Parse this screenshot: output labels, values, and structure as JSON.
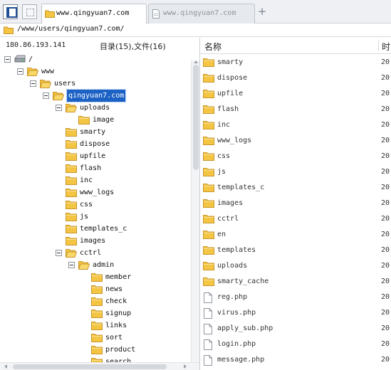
{
  "tabs": [
    {
      "label": "www.qingyuan7.com"
    },
    {
      "label": "www.qingyuan7.com"
    }
  ],
  "address": {
    "path": "/www/users/qingyuan7.com/"
  },
  "server": {
    "ip": "180.86.193.141"
  },
  "counts": {
    "label": "目录(15),文件(16)"
  },
  "list_header": {
    "name": "名称",
    "time": "时"
  },
  "tree": [
    {
      "label": "/",
      "depth": 0,
      "kind": "drive",
      "expanded": true
    },
    {
      "label": "www",
      "depth": 1,
      "kind": "folder",
      "expanded": true
    },
    {
      "label": "users",
      "depth": 2,
      "kind": "folder",
      "expanded": true
    },
    {
      "label": "qingyuan7.com",
      "depth": 3,
      "kind": "folder",
      "expanded": true,
      "selected": true
    },
    {
      "label": "uploads",
      "depth": 4,
      "kind": "folder",
      "expanded": true
    },
    {
      "label": "image",
      "depth": 5,
      "kind": "folder"
    },
    {
      "label": "smarty",
      "depth": 4,
      "kind": "folder"
    },
    {
      "label": "dispose",
      "depth": 4,
      "kind": "folder"
    },
    {
      "label": "upfile",
      "depth": 4,
      "kind": "folder"
    },
    {
      "label": "flash",
      "depth": 4,
      "kind": "folder"
    },
    {
      "label": "inc",
      "depth": 4,
      "kind": "folder"
    },
    {
      "label": "www_logs",
      "depth": 4,
      "kind": "folder"
    },
    {
      "label": "css",
      "depth": 4,
      "kind": "folder"
    },
    {
      "label": "js",
      "depth": 4,
      "kind": "folder"
    },
    {
      "label": "templates_c",
      "depth": 4,
      "kind": "folder"
    },
    {
      "label": "images",
      "depth": 4,
      "kind": "folder"
    },
    {
      "label": "cctrl",
      "depth": 4,
      "kind": "folder",
      "expanded": true
    },
    {
      "label": "admin",
      "depth": 5,
      "kind": "folder",
      "expanded": true
    },
    {
      "label": "member",
      "depth": 6,
      "kind": "folder"
    },
    {
      "label": "news",
      "depth": 6,
      "kind": "folder"
    },
    {
      "label": "check",
      "depth": 6,
      "kind": "folder"
    },
    {
      "label": "signup",
      "depth": 6,
      "kind": "folder"
    },
    {
      "label": "links",
      "depth": 6,
      "kind": "folder"
    },
    {
      "label": "sort",
      "depth": 6,
      "kind": "folder"
    },
    {
      "label": "product",
      "depth": 6,
      "kind": "folder"
    },
    {
      "label": "search",
      "depth": 6,
      "kind": "folder"
    }
  ],
  "files": [
    {
      "name": "smarty",
      "kind": "folder",
      "time": "20"
    },
    {
      "name": "dispose",
      "kind": "folder",
      "time": "20"
    },
    {
      "name": "upfile",
      "kind": "folder",
      "time": "20"
    },
    {
      "name": "flash",
      "kind": "folder",
      "time": "20"
    },
    {
      "name": "inc",
      "kind": "folder",
      "time": "20"
    },
    {
      "name": "www_logs",
      "kind": "folder",
      "time": "20"
    },
    {
      "name": "css",
      "kind": "folder",
      "time": "20"
    },
    {
      "name": "js",
      "kind": "folder",
      "time": "20"
    },
    {
      "name": "templates_c",
      "kind": "folder",
      "time": "20"
    },
    {
      "name": "images",
      "kind": "folder",
      "time": "20"
    },
    {
      "name": "cctrl",
      "kind": "folder",
      "time": "20"
    },
    {
      "name": "en",
      "kind": "folder",
      "time": "20"
    },
    {
      "name": "templates",
      "kind": "folder",
      "time": "20"
    },
    {
      "name": "uploads",
      "kind": "folder",
      "time": "20"
    },
    {
      "name": "smarty_cache",
      "kind": "folder",
      "time": "20"
    },
    {
      "name": "reg.php",
      "kind": "file",
      "time": "20"
    },
    {
      "name": "virus.php",
      "kind": "file",
      "time": "20"
    },
    {
      "name": "apply_sub.php",
      "kind": "file",
      "time": "20"
    },
    {
      "name": "login.php",
      "kind": "file",
      "time": "20"
    },
    {
      "name": "message.php",
      "kind": "file",
      "time": "20"
    }
  ],
  "colors": {
    "folder_fill": "#f4c542",
    "folder_edge": "#c9952a",
    "selection": "#1c61c4"
  }
}
